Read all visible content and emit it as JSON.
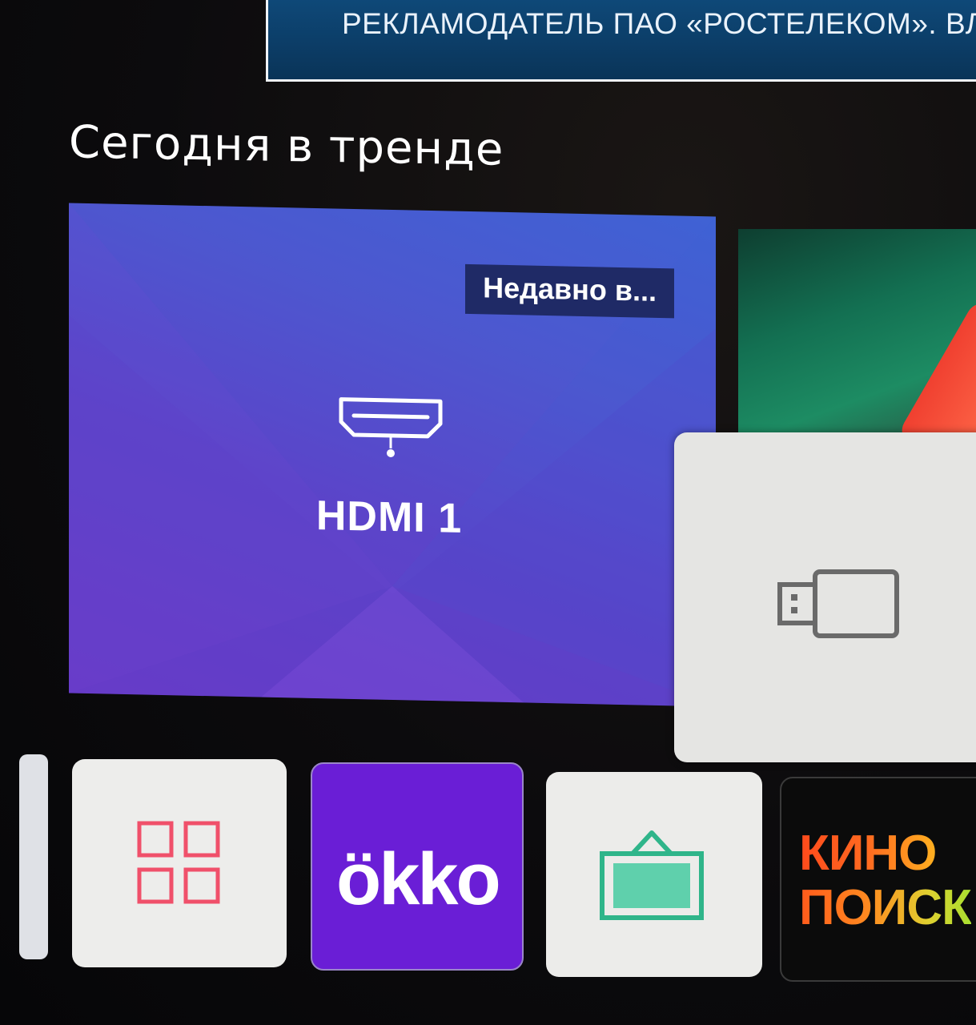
{
  "ad_banner": {
    "text": "РЕКЛАМОДАТЕЛЬ ПАО «РОСТЕЛЕКОМ». ВЛ"
  },
  "section": {
    "title": "Сегодня в тренде"
  },
  "feature_card": {
    "badge": "Недавно в...",
    "input_label": "HDMI 1",
    "icon": "hdmi-icon"
  },
  "usb_card": {
    "icon": "usb-drive-icon"
  },
  "apps": [
    {
      "id": "apps",
      "icon": "apps-grid-icon"
    },
    {
      "id": "okko",
      "label": "ökko"
    },
    {
      "id": "gallery",
      "icon": "gallery-frame-icon"
    },
    {
      "id": "kinopoisk",
      "line1": "КИНО",
      "line2": "ПОИСК"
    }
  ],
  "colors": {
    "feature_gradient_start": "#3f62d4",
    "feature_gradient_end": "#6a3bc8",
    "okko_purple": "#6a1ed6",
    "apps_icon_pink": "#f0506a",
    "gallery_icon_teal": "#2fb58a"
  }
}
